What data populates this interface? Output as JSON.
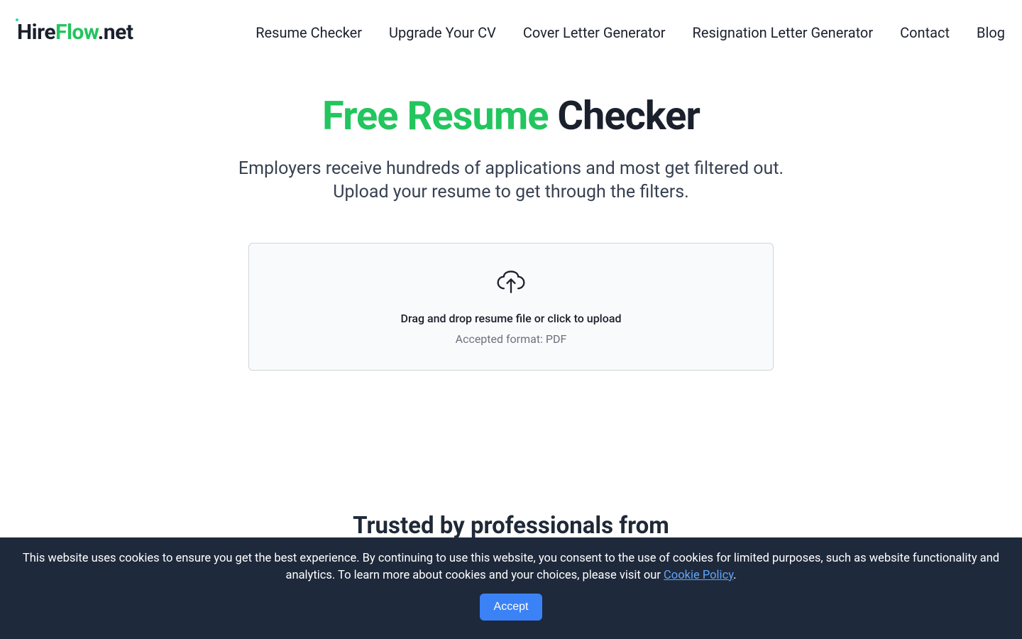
{
  "logo": {
    "part1": "Hire",
    "part2": "Flow",
    "part3": ".net"
  },
  "nav": {
    "items": [
      "Resume Checker",
      "Upgrade Your CV",
      "Cover Letter Generator",
      "Resignation Letter Generator",
      "Contact",
      "Blog"
    ]
  },
  "hero": {
    "title_green": "Free Resume",
    "title_dark": " Checker",
    "subtitle_line1": "Employers receive hundreds of applications and most get filtered out.",
    "subtitle_line2": "Upload your resume to get through the filters."
  },
  "upload": {
    "text": "Drag and drop resume file or click to upload",
    "hint": "Accepted format: PDF"
  },
  "trusted": {
    "title": "Trusted by professionals from"
  },
  "cookie": {
    "text1": "This website uses cookies to ensure you get the best experience. By continuing to use this website, you consent to the use of cookies for limited purposes, such as website functionality and analytics. To learn more about cookies and your choices, please visit our ",
    "link": "Cookie Policy",
    "text2": ".",
    "accept": "Accept"
  }
}
